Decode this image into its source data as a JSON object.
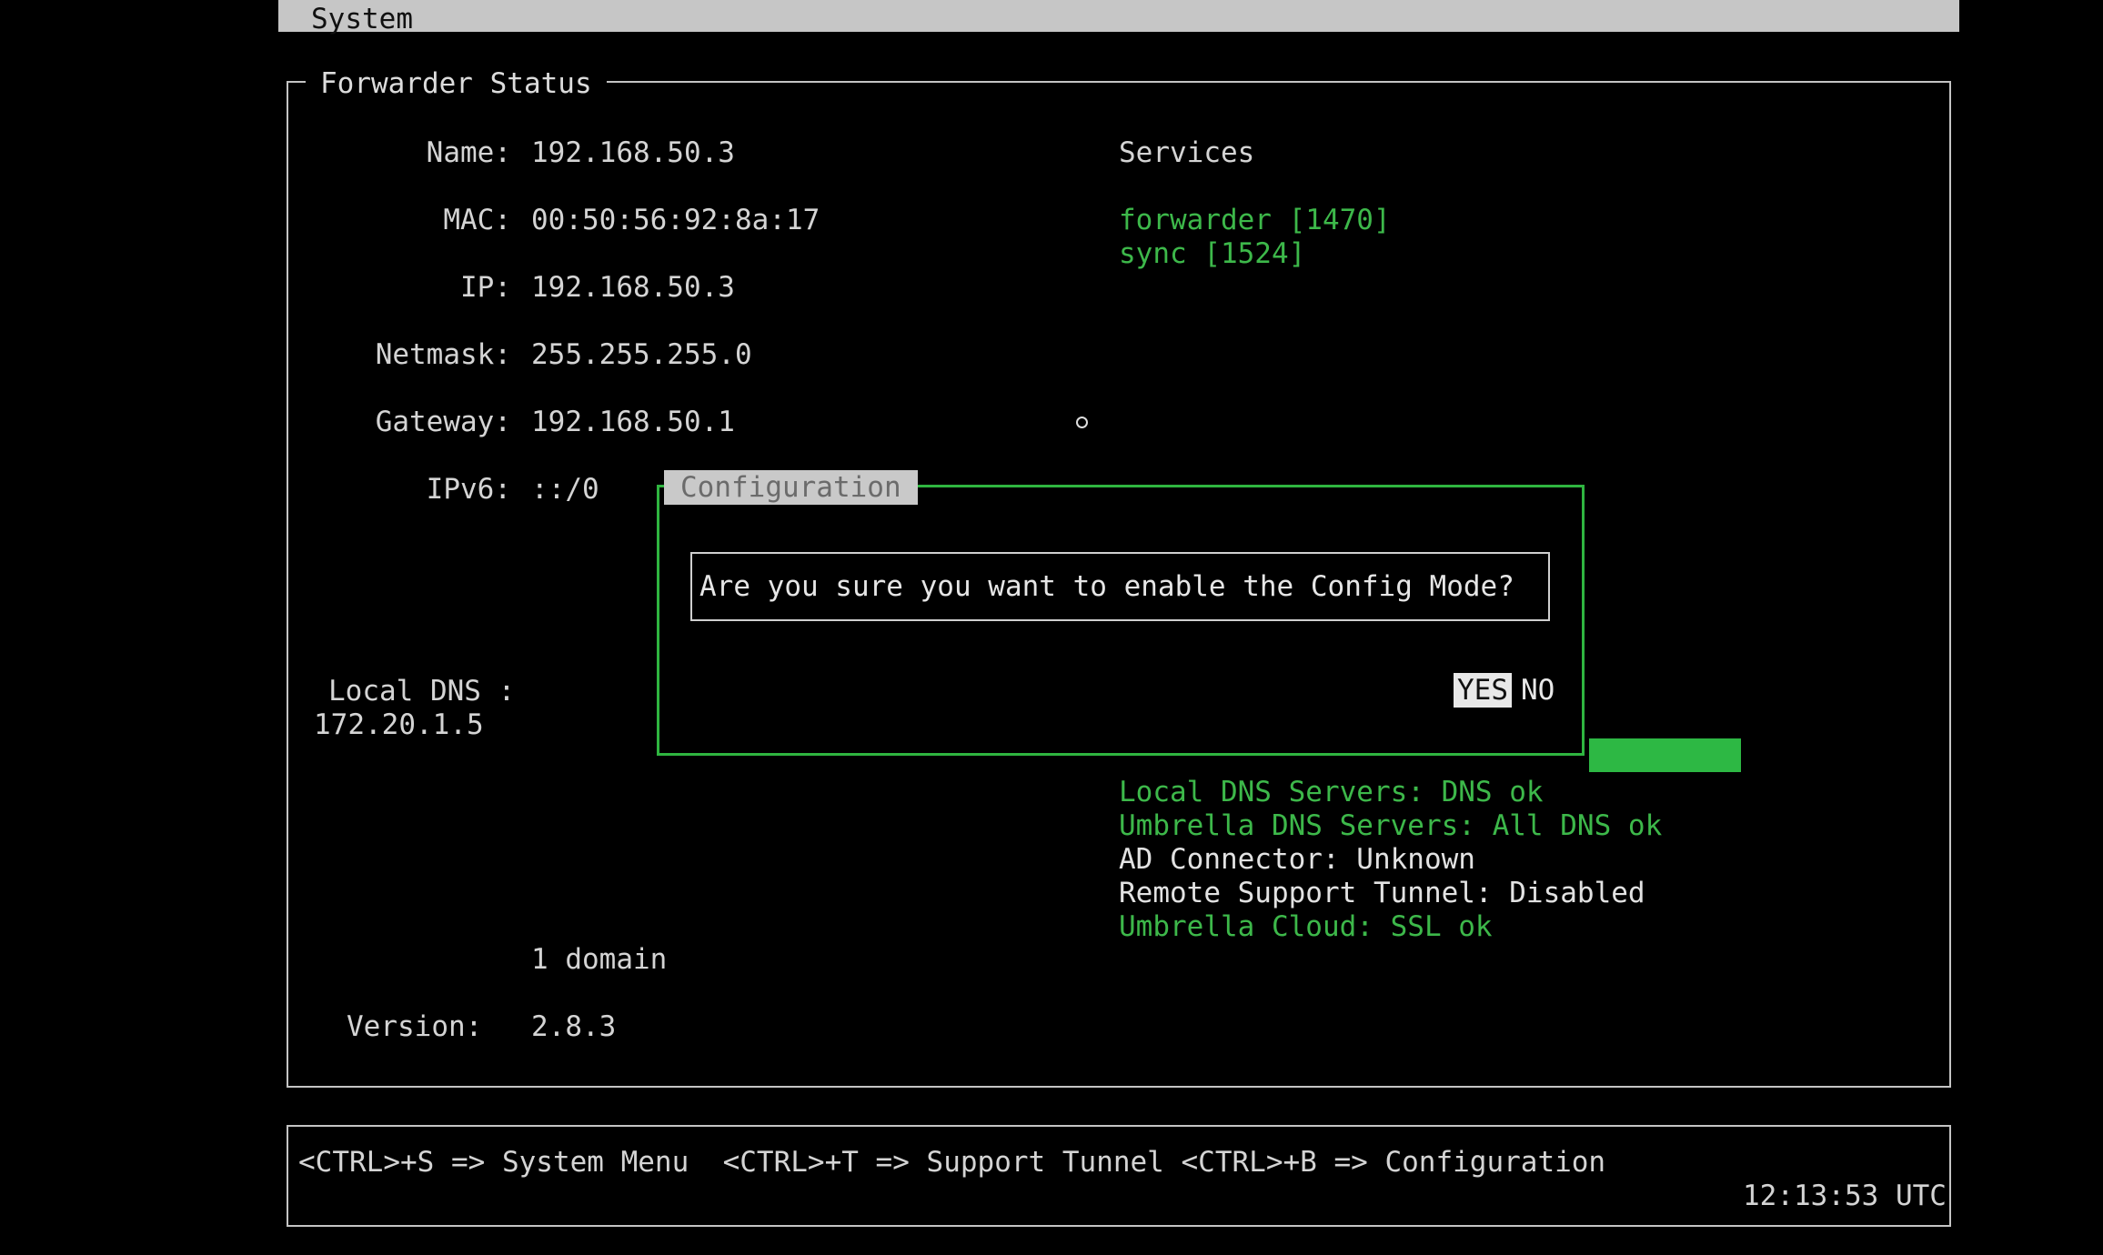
{
  "menubar": {
    "title": "System"
  },
  "forwarder_status": {
    "legend": "Forwarder Status",
    "fields": {
      "name_label": "Name:",
      "name_value": "192.168.50.3",
      "mac_label": "MAC:",
      "mac_value": "00:50:56:92:8a:17",
      "ip_label": "IP:",
      "ip_value": "192.168.50.3",
      "netmask_label": "Netmask:",
      "netmask_value": "255.255.255.0",
      "gateway_label": "Gateway:",
      "gateway_value": "192.168.50.1",
      "ipv6_label": "IPv6:",
      "ipv6_value": "::/0",
      "local_dns_label": "Local DNS :",
      "local_dns_value": "172.20.1.5",
      "domain_count": "1 domain",
      "version_label": "Version:",
      "version_value": "2.8.3"
    },
    "services": {
      "heading": "Services",
      "items": [
        "forwarder [1470]",
        "sync [1524]"
      ]
    },
    "status_lines": [
      {
        "text": "Local DNS Servers: DNS ok",
        "color": "#3db84a"
      },
      {
        "text": "Umbrella DNS Servers: All DNS ok",
        "color": "#3db84a"
      },
      {
        "text": "AD Connector: Unknown",
        "color": "#e2e2e2"
      },
      {
        "text": "Remote Support Tunnel: Disabled",
        "color": "#e2e2e2"
      },
      {
        "text": "Umbrella Cloud: SSL ok",
        "color": "#3db84a"
      }
    ]
  },
  "dialog": {
    "title": "Configuration",
    "message": "Are you sure you want to enable the Config Mode?",
    "yes_label": "YES",
    "no_label": "NO",
    "accent_color": "#2fb540"
  },
  "footer": {
    "shortcuts": "<CTRL>+S => System Menu  <CTRL>+T => Support Tunnel <CTRL>+B => Configuration",
    "clock": "12:13:53 UTC"
  }
}
